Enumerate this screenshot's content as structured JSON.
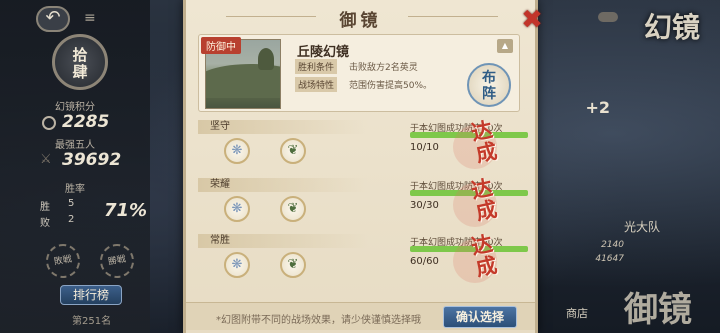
{
  "left_panel": {
    "back_label": "↶",
    "menu_label": "≡",
    "rank_title": "拾\n肆",
    "points_label": "幻镜积分",
    "points_value": "2285",
    "best_label": "最强五人",
    "best_value": "39692",
    "win_rate_label": "胜率",
    "wins_label": "胜",
    "wins_value": "5",
    "losses_label": "败",
    "losses_value": "2",
    "win_rate_value": "71%",
    "seal_left": "敗戦",
    "seal_right": "勝戦",
    "rank_button": "排行榜",
    "rank_position": "第251名"
  },
  "dialog": {
    "title": "御镜",
    "close_label": "✖",
    "defend_tag": "防御中",
    "scene_name": "丘陵幻镜",
    "conditions": [
      {
        "label": "胜利条件",
        "text": "击败敌方2名英灵"
      },
      {
        "label": "战场特性",
        "text": "范围伤害提高50%。"
      }
    ],
    "collapse_label": "▲",
    "formation_label": "布\n阵",
    "tasks": [
      {
        "name": "坚守",
        "reward1_icon": "feather-icon",
        "reward2_icon": "leaf-icon",
        "desc": "于本幻图成功防守10次",
        "progress": "10/10",
        "progress_fraction": 1.0,
        "stamp": "达\n成"
      },
      {
        "name": "荣耀",
        "reward1_icon": "feather-icon",
        "reward2_icon": "leaf-icon",
        "desc": "于本幻图成功防守30次",
        "progress": "30/30",
        "progress_fraction": 1.0,
        "stamp": "达\n成"
      },
      {
        "name": "常胜",
        "reward1_icon": "feather-icon",
        "reward2_icon": "leaf-icon",
        "desc": "于本幻图成功防守60次",
        "progress": "60/60",
        "progress_fraction": 1.0,
        "stamp": "达\n成"
      }
    ],
    "footer_note": "*幻图附带不同的战场效果，请少侠谨慎选择哦",
    "confirm_label": "确认选择"
  },
  "right_panel": {
    "title": "幻镜",
    "plus": "+2",
    "team_name": "光大队",
    "num1": "2140",
    "num2": "41647",
    "shop_label": "商店",
    "bottom_title": "御镜"
  }
}
